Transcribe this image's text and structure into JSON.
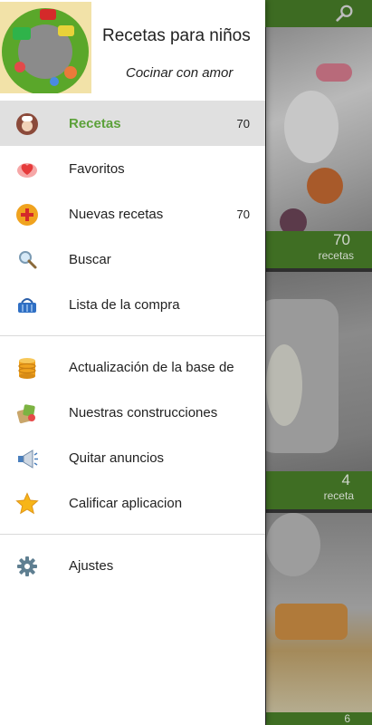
{
  "drawer": {
    "title": "Recetas para niños",
    "subtitle": "Cocinar con amor",
    "items": [
      {
        "label": "Recetas",
        "count": "70",
        "icon": "chef-avatar-icon"
      },
      {
        "label": "Favoritos",
        "count": "",
        "icon": "heart-icon"
      },
      {
        "label": "Nuevas recetas",
        "count": "70",
        "icon": "plus-circle-icon"
      },
      {
        "label": "Buscar",
        "count": "",
        "icon": "search-icon"
      },
      {
        "label": "Lista de la compra",
        "count": "",
        "icon": "basket-icon"
      },
      {
        "label": "Actualización de la base de",
        "count": "",
        "icon": "database-icon"
      },
      {
        "label": "Nuestras construcciones",
        "count": "",
        "icon": "apps-icon"
      },
      {
        "label": "Quitar anuncios",
        "count": "",
        "icon": "megaphone-icon"
      },
      {
        "label": "Calificar aplicacion",
        "count": "",
        "icon": "star-icon"
      },
      {
        "label": "Ajustes",
        "count": "",
        "icon": "gear-icon"
      }
    ]
  },
  "background": {
    "cards": [
      {
        "count": "70",
        "unit": "recetas"
      },
      {
        "count": "4",
        "unit": "receta"
      },
      {
        "count": "6",
        "unit": ""
      }
    ]
  },
  "colors": {
    "accent": "#5ca13a",
    "toolbar": "#3d6b22",
    "active_item_bg": "#e0e0e0"
  }
}
